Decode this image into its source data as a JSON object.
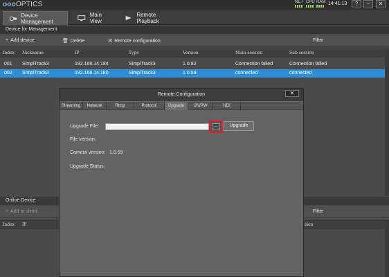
{
  "titlebar": {
    "logo_prefix": "ooo",
    "logo_text": "OPTICS",
    "net_label": "NET",
    "cpu_label": "CPU",
    "ram_label": "RAM",
    "time": "14:41:13",
    "help_label": "?",
    "minimize_label": "–",
    "close_label": "✕"
  },
  "main_tabs": [
    {
      "label": "Device Management",
      "icon": "device-management-icon",
      "active": true
    },
    {
      "label": "Main View",
      "icon": "monitor-icon",
      "active": false
    },
    {
      "label": "Remote Playback",
      "icon": "playback-icon",
      "active": false
    }
  ],
  "device_section": {
    "title": "Device for Management",
    "add_label": "Add device",
    "delete_label": "Delete",
    "remote_config_label": "Remote configuration",
    "filter_label": "Filter"
  },
  "device_table": {
    "columns": [
      "Index",
      "Nickname",
      "IP",
      "Type",
      "Version",
      "Main session",
      "Sub session"
    ],
    "rows": [
      {
        "index": "001",
        "nickname": "SimplTrack3",
        "ip": "192.168.14.184",
        "type": "SimplTrack3",
        "version": "1.0.82",
        "main_session": "Connection failed",
        "sub_session": "Connection failed",
        "selected": false
      },
      {
        "index": "002",
        "nickname": "SimplTrack3",
        "ip": "192.168.14.180",
        "type": "SimplTrack3",
        "version": "1.0.59",
        "main_session": "connected",
        "sub_session": "connected",
        "selected": true
      }
    ]
  },
  "online_section": {
    "title": "Online Device",
    "add_label": "Add to client",
    "filter_label": "Filter",
    "col_index": "Index",
    "col_ip": "IP",
    "col_version": "sion"
  },
  "dialog": {
    "title": "Remote Configuration",
    "close_label": "✕",
    "tabs": [
      "Streaming",
      "Network",
      "Rtmp",
      "Protocol",
      "Upgrade",
      "UN/PW",
      "NDI"
    ],
    "active_tab": "Upgrade",
    "upgrade_file_label": "Upgrade File:",
    "upgrade_file_value": "",
    "browse_label": "...",
    "upgrade_button": "Upgrade",
    "file_version_label": "File version:",
    "camera_version_label": "Camera version:",
    "camera_version_value": "1.0.59",
    "upgrade_status_label": "Upgrade Status:"
  },
  "colors": {
    "selected_row": "#2f8fd6",
    "highlight_border": "#e02020"
  }
}
